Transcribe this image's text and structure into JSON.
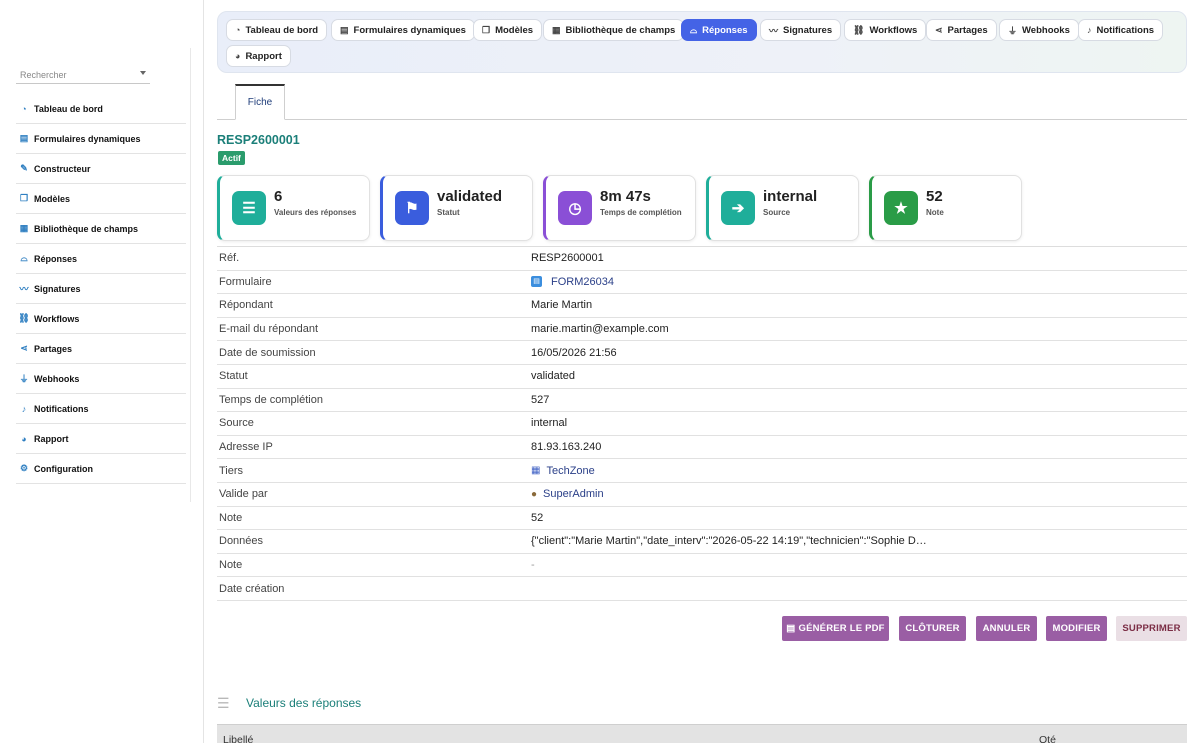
{
  "sidebar": {
    "search_placeholder": "Rechercher",
    "items": [
      {
        "label": "Tableau de bord",
        "icon": "dashboard-icon"
      },
      {
        "label": "Formulaires dynamiques",
        "icon": "form-icon"
      },
      {
        "label": "Constructeur",
        "icon": "wand-icon"
      },
      {
        "label": "Modèles",
        "icon": "copy-icon"
      },
      {
        "label": "Bibliothèque de champs",
        "icon": "list-icon"
      },
      {
        "label": "Réponses",
        "icon": "inbox-icon"
      },
      {
        "label": "Signatures",
        "icon": "signature-icon"
      },
      {
        "label": "Workflows",
        "icon": "workflow-icon"
      },
      {
        "label": "Partages",
        "icon": "share-icon"
      },
      {
        "label": "Webhooks",
        "icon": "plug-icon"
      },
      {
        "label": "Notifications",
        "icon": "bell-icon"
      },
      {
        "label": "Rapport",
        "icon": "chart-pie-icon"
      },
      {
        "label": "Configuration",
        "icon": "gear-icon"
      }
    ]
  },
  "tabs": [
    {
      "label": "Tableau de bord",
      "icon": "dashboard-icon"
    },
    {
      "label": "Formulaires dynamiques",
      "icon": "form-icon"
    },
    {
      "label": "Modèles",
      "icon": "copy-icon"
    },
    {
      "label": "Bibliothèque de champs",
      "icon": "list-icon"
    },
    {
      "label": "Réponses",
      "icon": "inbox-icon",
      "active": true
    },
    {
      "label": "Signatures",
      "icon": "signature-icon"
    },
    {
      "label": "Workflows",
      "icon": "workflow-icon"
    },
    {
      "label": "Partages",
      "icon": "share-icon"
    },
    {
      "label": "Webhooks",
      "icon": "plug-icon"
    },
    {
      "label": "Notifications",
      "icon": "bell-icon"
    },
    {
      "label": "Rapport",
      "icon": "chart-pie-icon"
    }
  ],
  "subtab": "Fiche",
  "record": {
    "ref": "RESP2600001",
    "status_badge": "Actif"
  },
  "stats": [
    {
      "value": "6",
      "label": "Valeurs des réponses",
      "color": "#1fae9a",
      "icon": "list-icon"
    },
    {
      "value": "validated",
      "label": "Statut",
      "color": "#3a5ddd",
      "icon": "flag-icon"
    },
    {
      "value": "8m 47s",
      "label": "Temps de complétion",
      "color": "#8a4fd6",
      "icon": "clock-icon"
    },
    {
      "value": "internal",
      "label": "Source",
      "color": "#1fae9a",
      "icon": "sign-in-icon"
    },
    {
      "value": "52",
      "label": "Note",
      "color": "#2a9c47",
      "icon": "star-icon"
    }
  ],
  "fields": [
    {
      "label": "Réf.",
      "value": "RESP2600001"
    },
    {
      "label": "Formulaire",
      "value": "FORM26034",
      "link": true,
      "icon": "form-icon"
    },
    {
      "label": "Répondant",
      "value": "Marie Martin"
    },
    {
      "label": "E-mail du répondant",
      "value": "marie.martin@example.com"
    },
    {
      "label": "Date de soumission",
      "value": "16/05/2026 21:56"
    },
    {
      "label": "Statut",
      "value": "validated"
    },
    {
      "label": "Temps de complétion",
      "value": "527"
    },
    {
      "label": "Source",
      "value": "internal"
    },
    {
      "label": "Adresse IP",
      "value": "81.93.163.240"
    },
    {
      "label": "Tiers",
      "value": "TechZone",
      "link": true,
      "icon": "building-icon"
    },
    {
      "label": "Valide par",
      "value": "SuperAdmin",
      "link": true,
      "icon": "user-icon"
    },
    {
      "label": "Note",
      "value": "52"
    },
    {
      "label": "Données",
      "value": "{\"client\":\"Marie Martin\",\"date_interv\":\"2026-05-22 14:19\",\"technicien\":\"Sophie D…"
    },
    {
      "label": "Note",
      "value": "-",
      "muted": true
    },
    {
      "label": "Date création",
      "value": ""
    }
  ],
  "actions": {
    "pdf": "GÉNÉRER LE PDF",
    "close": "CLÔTURER",
    "cancel": "ANNULER",
    "edit": "MODIFIER",
    "delete": "SUPPRIMER"
  },
  "values_section": {
    "title": "Valeurs des réponses",
    "columns": [
      "Libellé",
      "Qté"
    ]
  }
}
